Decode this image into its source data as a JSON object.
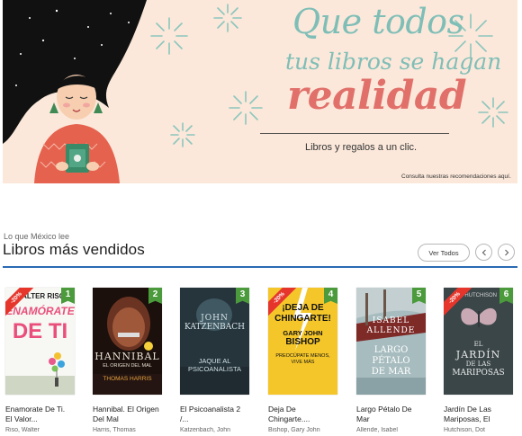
{
  "banner": {
    "line1": "Que todos",
    "line2": "tus libros se hagan",
    "line3": "realidad",
    "subtitle": "Libros y regalos a un clic.",
    "cta": "Consulta nuestras recomendaciones aquí.",
    "colors": {
      "background": "#fbe8da",
      "teal": "#7fbeb7",
      "coral": "#e1706a"
    }
  },
  "section": {
    "kicker": "Lo que México lee",
    "title": "Libros más vendidos",
    "ver_todos": "Ver Todos",
    "prev_icon": "chevron-left-icon",
    "next_icon": "chevron-right-icon",
    "accent": "#2a6ab3"
  },
  "books": [
    {
      "rank": "1",
      "discount": "-20%",
      "title": "Enamorate De Ti. El Valor...",
      "author": "Riso, Walter",
      "cover_lines": [
        "WALTER RISO",
        "ENAMÓRATE",
        "DE TI"
      ]
    },
    {
      "rank": "2",
      "discount": "",
      "title": "Hannibal. El Origen Del Mal",
      "author": "Harris, Thomas",
      "cover_lines": [
        "HANNIBAL",
        "EL ORIGEN DEL MAL",
        "THOMAS HARRIS"
      ]
    },
    {
      "rank": "3",
      "discount": "",
      "title": "El Psicoanalista 2 /...",
      "author": "Katzenbach, John",
      "cover_lines": [
        "JOHN",
        "KATZENBACH",
        "JAQUE AL",
        "PSICOANALISTA"
      ]
    },
    {
      "rank": "4",
      "discount": "-20%",
      "title": "Deja De Chingarte....",
      "author": "Bishop, Gary John",
      "cover_lines": [
        "¡DEJA DE",
        "CHINGARTE!",
        "GARY JOHN",
        "BISHOP",
        "PREOCÚPATE MENOS,",
        "VIVE MÁS"
      ]
    },
    {
      "rank": "5",
      "discount": "",
      "title": "Largo Pétalo De Mar",
      "author": "Allende, Isabel",
      "cover_lines": [
        "ISABEL",
        "ALLENDE",
        "LARGO",
        "PÉTALO",
        "DE MAR"
      ]
    },
    {
      "rank": "6",
      "discount": "-20%",
      "title": "Jardín De Las Mariposas, El",
      "author": "Hutchison, Dot",
      "cover_lines": [
        "HUTCHISON",
        "EL",
        "JARDÍN",
        "DE LAS",
        "MARIPOSAS"
      ]
    }
  ]
}
